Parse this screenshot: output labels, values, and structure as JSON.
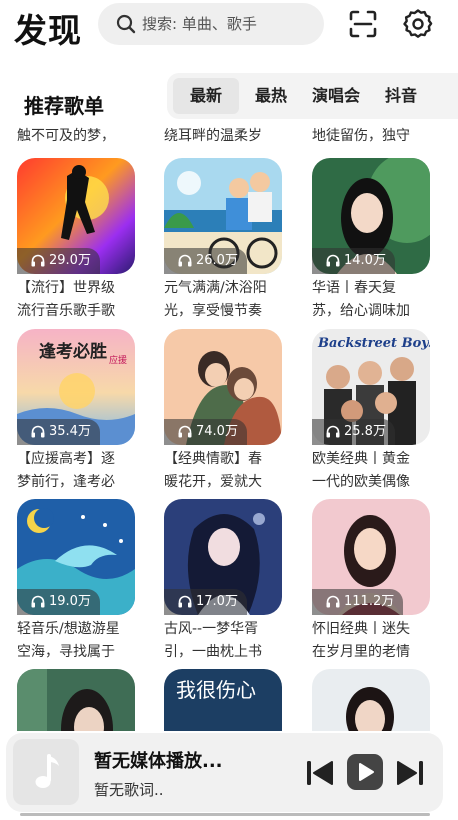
{
  "header": {
    "title": "发现",
    "search_placeholder": "搜索: 单曲、歌手",
    "scan_icon": "scan-icon",
    "settings_icon": "gear-icon"
  },
  "section": {
    "title": "推荐歌单",
    "tabs": [
      {
        "label": "最新",
        "active": true
      },
      {
        "label": "最热",
        "active": false
      },
      {
        "label": "演唱会",
        "active": false
      },
      {
        "label": "抖音",
        "active": false
      }
    ]
  },
  "top_partial_lines": [
    "触不可及的梦，",
    "绕耳畔的温柔岁",
    "地徒留伤，独守"
  ],
  "playlists": [
    {
      "plays": "29.0万",
      "line1": "【流行】世界级",
      "line2": "流行音乐歌手歌"
    },
    {
      "plays": "26.0万",
      "line1": "元气满满/沐浴阳",
      "line2": "光，享受慢节奏"
    },
    {
      "plays": "14.0万",
      "line1": "华语丨春天复",
      "line2": "苏，给心调味加"
    },
    {
      "plays": "35.4万",
      "line1": "【应援高考】逐",
      "line2": "梦前行，逢考必",
      "cover_text": "逢考必胜",
      "cover_sub": "应援"
    },
    {
      "plays": "74.0万",
      "line1": "【经典情歌】春",
      "line2": "暖花开，爱就大"
    },
    {
      "plays": "25.8万",
      "line1": "欧美经典丨黄金",
      "line2": "一代的欧美偶像",
      "cover_text": "Backstreet Boys"
    },
    {
      "plays": "19.0万",
      "line1": "轻音乐/想遨游星",
      "line2": "空海，寻找属于"
    },
    {
      "plays": "17.0万",
      "line1": "古风--一梦华胥",
      "line2": "引，一曲枕上书"
    },
    {
      "plays": "111.2万",
      "line1": "怀旧经典丨迷失",
      "line2": "在岁月里的老情"
    },
    {
      "plays": "",
      "line1": "",
      "line2": ""
    },
    {
      "plays": "",
      "line1": "",
      "line2": "",
      "cover_text": "我很伤心"
    },
    {
      "plays": "",
      "line1": "",
      "line2": ""
    }
  ],
  "player": {
    "title": "暂无媒体播放...",
    "lyrics": "暂无歌词..",
    "art_icon": "music-note-icon",
    "prev_icon": "skip-previous-icon",
    "play_icon": "play-icon",
    "next_icon": "skip-next-icon"
  }
}
